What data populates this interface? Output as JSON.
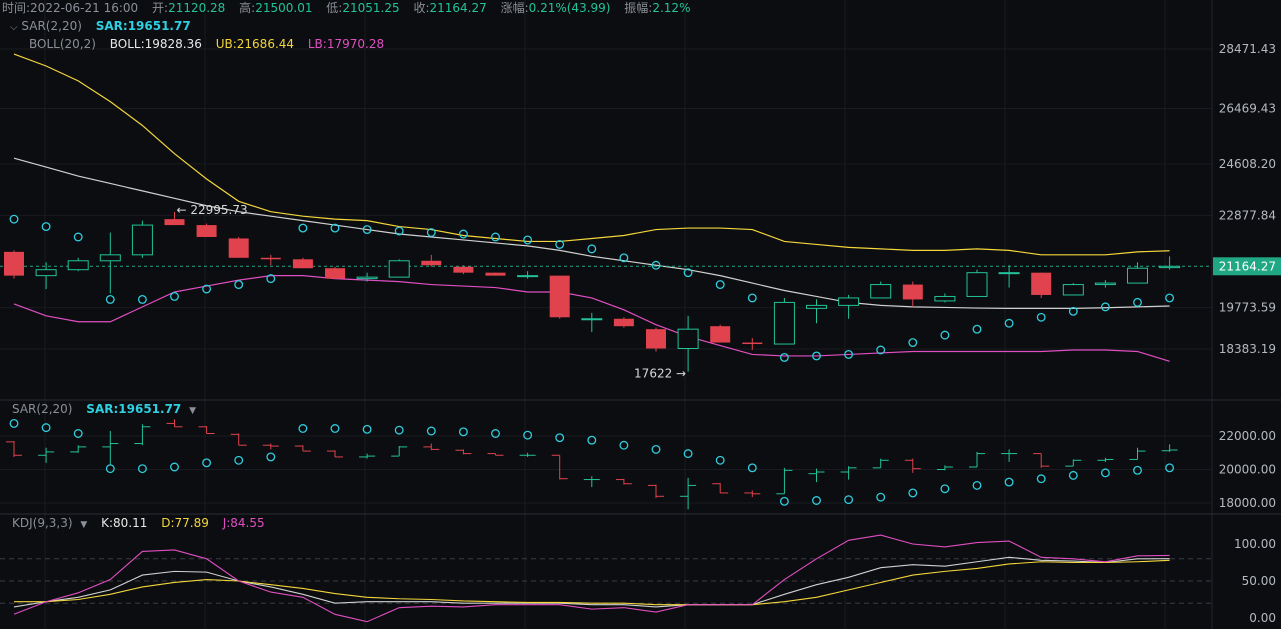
{
  "header": {
    "time_label": "时间:",
    "time_value": "2022-06-21 16:00",
    "open_label": "开:",
    "open_value": "21120.28",
    "high_label": "高:",
    "high_value": "21500.01",
    "low_label": "低:",
    "low_value": "21051.25",
    "close_label": "收:",
    "close_value": "21164.27",
    "chg_label": "涨幅:",
    "chg_value": "0.21%(43.99)",
    "amp_label": "振幅:",
    "amp_value": "2.12%"
  },
  "main_legend": {
    "sar_name": "SAR(2,20)",
    "sar_value": "SAR:19651.77",
    "boll_name": "BOLL(20,2)",
    "boll_value": "BOLL:19828.36",
    "ub_value": "UB:21686.44",
    "lb_value": "LB:17970.28"
  },
  "sar_legend": {
    "name": "SAR(2,20)",
    "value": "SAR:19651.77"
  },
  "kdj_legend": {
    "name": "KDJ(9,3,3)",
    "k": "K:80.11",
    "d": "D:77.89",
    "j": "J:84.55"
  },
  "colors": {
    "up": "#22c39a",
    "down": "#e0424e",
    "sar": "#2ecfe0",
    "mid": "#d0d0d0",
    "ub": "#f3d63c",
    "lb": "#e04fc2",
    "price_tag": "#1fa883"
  },
  "chart_data": [
    {
      "type": "candlestick",
      "panel": "main",
      "y_ticks": [
        28471.43,
        26469.43,
        24608.2,
        22877.84,
        19773.59,
        18383.19
      ],
      "y_tick_labels": [
        "28471.43",
        "26469.43",
        "24608.20",
        "22877.84",
        "19773.59",
        "18383.19"
      ],
      "last_price": 21164.27,
      "last_price_label": "21164.27",
      "high_marker": {
        "index": 5,
        "value": 22995.73,
        "label": "← 22995.73"
      },
      "low_marker": {
        "index": 21,
        "value": 17622,
        "label": "17622 →"
      },
      "candles": [
        {
          "o": 21650,
          "h": 21700,
          "l": 20750,
          "c": 20850
        },
        {
          "o": 20850,
          "h": 21300,
          "l": 20400,
          "c": 21050
        },
        {
          "o": 21050,
          "h": 21450,
          "l": 21000,
          "c": 21350
        },
        {
          "o": 21350,
          "h": 22300,
          "l": 20250,
          "c": 21550
        },
        {
          "o": 21550,
          "h": 22700,
          "l": 21450,
          "c": 22550
        },
        {
          "o": 22750,
          "h": 22995.73,
          "l": 22550,
          "c": 22550
        },
        {
          "o": 22550,
          "h": 22600,
          "l": 22150,
          "c": 22150
        },
        {
          "o": 22100,
          "h": 22150,
          "l": 21450,
          "c": 21450
        },
        {
          "o": 21450,
          "h": 21550,
          "l": 21200,
          "c": 21400
        },
        {
          "o": 21400,
          "h": 21450,
          "l": 21100,
          "c": 21100
        },
        {
          "o": 21100,
          "h": 21150,
          "l": 20750,
          "c": 20750
        },
        {
          "o": 20750,
          "h": 20950,
          "l": 20650,
          "c": 20800
        },
        {
          "o": 20800,
          "h": 21400,
          "l": 20800,
          "c": 21350
        },
        {
          "o": 21350,
          "h": 21550,
          "l": 21150,
          "c": 21200
        },
        {
          "o": 21150,
          "h": 21200,
          "l": 20900,
          "c": 20950
        },
        {
          "o": 20950,
          "h": 20950,
          "l": 20850,
          "c": 20850
        },
        {
          "o": 20850,
          "h": 21000,
          "l": 20750,
          "c": 20850
        },
        {
          "o": 20850,
          "h": 20850,
          "l": 19400,
          "c": 19450
        },
        {
          "o": 19400,
          "h": 19600,
          "l": 18950,
          "c": 19400
        },
        {
          "o": 19400,
          "h": 19450,
          "l": 19100,
          "c": 19150
        },
        {
          "o": 19050,
          "h": 19100,
          "l": 18300,
          "c": 18400
        },
        {
          "o": 18400,
          "h": 19500,
          "l": 17622,
          "c": 19050
        },
        {
          "o": 19150,
          "h": 19200,
          "l": 18600,
          "c": 18600
        },
        {
          "o": 18600,
          "h": 18750,
          "l": 18350,
          "c": 18550
        },
        {
          "o": 18550,
          "h": 20100,
          "l": 18550,
          "c": 19950
        },
        {
          "o": 19750,
          "h": 20050,
          "l": 19250,
          "c": 19850
        },
        {
          "o": 19850,
          "h": 20200,
          "l": 19400,
          "c": 20100
        },
        {
          "o": 20100,
          "h": 20650,
          "l": 20100,
          "c": 20550
        },
        {
          "o": 20550,
          "h": 20650,
          "l": 19800,
          "c": 20050
        },
        {
          "o": 20000,
          "h": 20250,
          "l": 19950,
          "c": 20150
        },
        {
          "o": 20150,
          "h": 21050,
          "l": 20150,
          "c": 20950
        },
        {
          "o": 20950,
          "h": 21200,
          "l": 20450,
          "c": 20950
        },
        {
          "o": 20950,
          "h": 20950,
          "l": 20100,
          "c": 20200
        },
        {
          "o": 20200,
          "h": 20600,
          "l": 20200,
          "c": 20550
        },
        {
          "o": 20550,
          "h": 20700,
          "l": 20450,
          "c": 20600
        },
        {
          "o": 20600,
          "h": 21300,
          "l": 20600,
          "c": 21100
        },
        {
          "o": 21120.28,
          "h": 21500.01,
          "l": 21051.25,
          "c": 21164.27
        }
      ],
      "sar": [
        22750,
        22500,
        22150,
        20050,
        20050,
        20150,
        20400,
        20550,
        20750,
        22450,
        22450,
        22400,
        22350,
        22300,
        22250,
        22150,
        22050,
        21900,
        21750,
        21450,
        21200,
        20950,
        20550,
        20100,
        18100,
        18150,
        18200,
        18350,
        18600,
        18850,
        19050,
        19250,
        19450,
        19650,
        19800,
        19951,
        20100
      ],
      "boll_mid": [
        24800,
        24500,
        24200,
        23950,
        23700,
        23450,
        23200,
        23000,
        22850,
        22700,
        22550,
        22400,
        22250,
        22150,
        22050,
        21950,
        21850,
        21700,
        21500,
        21350,
        21200,
        21050,
        20850,
        20600,
        20350,
        20150,
        19950,
        19850,
        19800,
        19780,
        19760,
        19750,
        19750,
        19750,
        19770,
        19800,
        19828.36
      ],
      "boll_ub": [
        28300,
        27900,
        27400,
        26700,
        25900,
        24950,
        24100,
        23350,
        23000,
        22850,
        22750,
        22700,
        22500,
        22400,
        22200,
        22100,
        22000,
        22000,
        22100,
        22200,
        22400,
        22450,
        22450,
        22400,
        22000,
        21900,
        21800,
        21750,
        21700,
        21700,
        21750,
        21700,
        21550,
        21550,
        21550,
        21650,
        21686.44
      ],
      "boll_lb": [
        19900,
        19500,
        19300,
        19300,
        19800,
        20300,
        20500,
        20700,
        20850,
        20850,
        20750,
        20700,
        20650,
        20550,
        20500,
        20450,
        20300,
        20300,
        20100,
        19700,
        19200,
        18800,
        18500,
        18200,
        18150,
        18150,
        18200,
        18250,
        18300,
        18300,
        18300,
        18300,
        18300,
        18350,
        18350,
        18300,
        17970.28
      ]
    },
    {
      "type": "line",
      "panel": "sar",
      "y_ticks": [
        22000,
        20000,
        18000
      ],
      "y_tick_labels": [
        "22000.00",
        "20000.00",
        "18000.00"
      ],
      "note": "uses candles and sar from main panel"
    },
    {
      "type": "line",
      "panel": "kdj",
      "y_ticks": [
        100,
        50,
        0
      ],
      "y_tick_labels": [
        "100.00",
        "50.00",
        "0.00"
      ],
      "series": [
        {
          "name": "K",
          "values": [
            15,
            22,
            28,
            38,
            58,
            63,
            62,
            50,
            42,
            32,
            20,
            22,
            22,
            22,
            20,
            20,
            20,
            20,
            18,
            18,
            15,
            18,
            18,
            18,
            32,
            45,
            55,
            68,
            72,
            70,
            76,
            82,
            78,
            77,
            75,
            80,
            80.11
          ]
        },
        {
          "name": "D",
          "values": [
            22,
            22,
            25,
            32,
            42,
            48,
            52,
            50,
            45,
            40,
            33,
            28,
            26,
            25,
            23,
            22,
            21,
            21,
            20,
            20,
            18,
            18,
            18,
            18,
            22,
            28,
            38,
            48,
            58,
            63,
            67,
            73,
            76,
            75,
            75,
            76,
            77.89
          ]
        },
        {
          "name": "J",
          "values": [
            5,
            22,
            34,
            52,
            90,
            92,
            80,
            50,
            35,
            28,
            5,
            -5,
            14,
            16,
            15,
            18,
            18,
            18,
            12,
            14,
            8,
            18,
            18,
            18,
            52,
            80,
            105,
            112,
            100,
            96,
            102,
            104,
            82,
            80,
            76,
            84,
            84.55
          ]
        }
      ]
    }
  ]
}
